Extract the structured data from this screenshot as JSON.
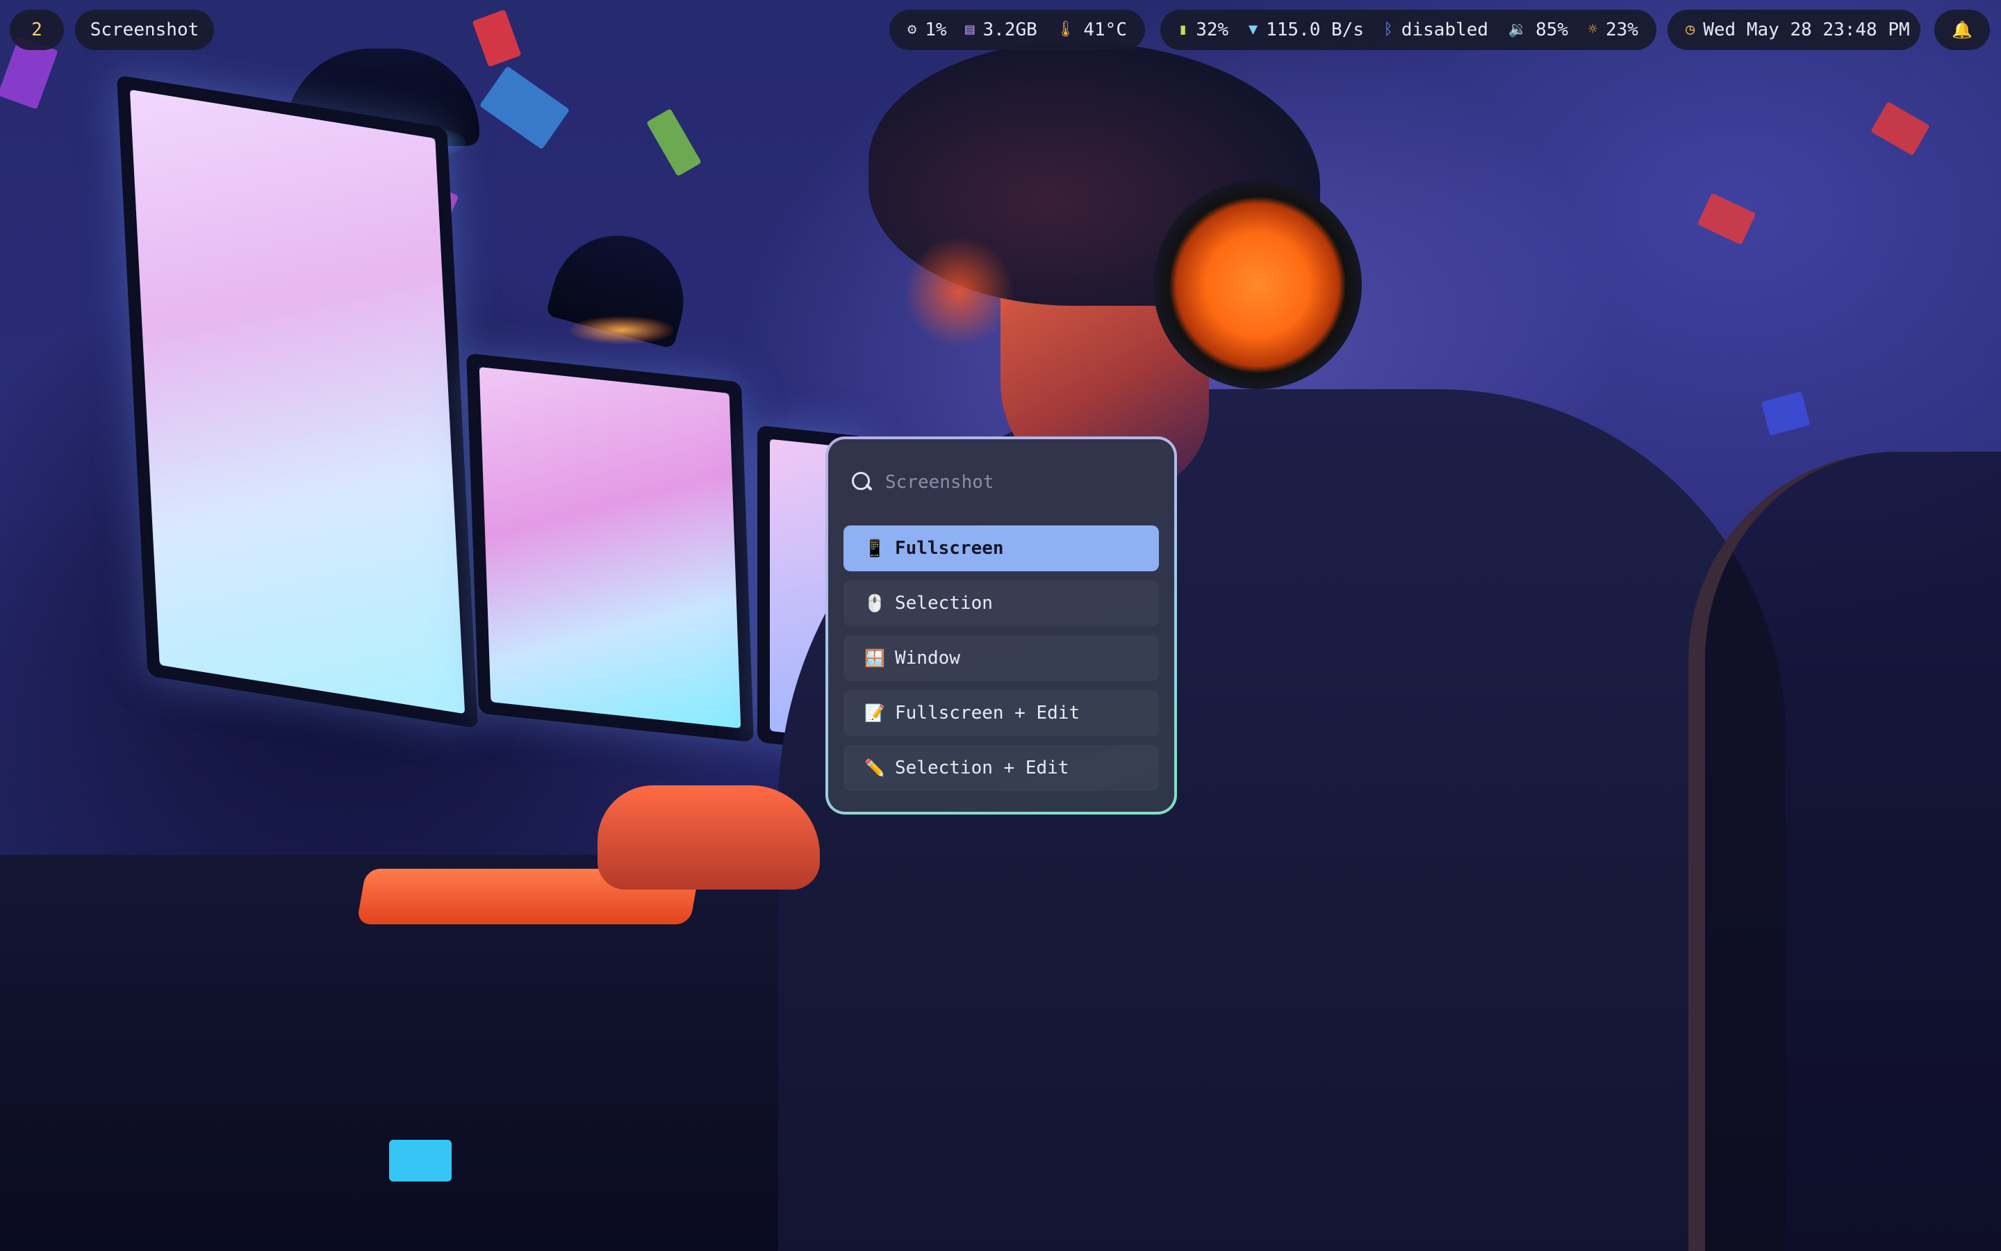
{
  "topbar": {
    "workspace": "2",
    "window_title": "Screenshot",
    "system": {
      "cpu": "1%",
      "memory": "3.2GB",
      "temperature": "41°C"
    },
    "status": {
      "battery": "32%",
      "network": "115.0 B/s",
      "bluetooth": "disabled",
      "volume": "85%",
      "brightness": "23%"
    },
    "clock": "Wed May 28 23:48 PM"
  },
  "launcher": {
    "search_placeholder": "Screenshot",
    "search_value": "",
    "entries": [
      {
        "icon": "📱",
        "label": "Fullscreen",
        "selected": true
      },
      {
        "icon": "🖱️",
        "label": "Selection",
        "selected": false
      },
      {
        "icon": "🪟",
        "label": "Window",
        "selected": false
      },
      {
        "icon": "📝",
        "label": "Fullscreen + Edit",
        "selected": false
      },
      {
        "icon": "✏️",
        "label": "Selection + Edit",
        "selected": false
      }
    ]
  },
  "colors": {
    "bar_bg": "#181a2c",
    "selected_entry": "#8fb0f2",
    "border_gradient_start": "#b9b0e6",
    "border_gradient_end": "#7fe1c2"
  }
}
